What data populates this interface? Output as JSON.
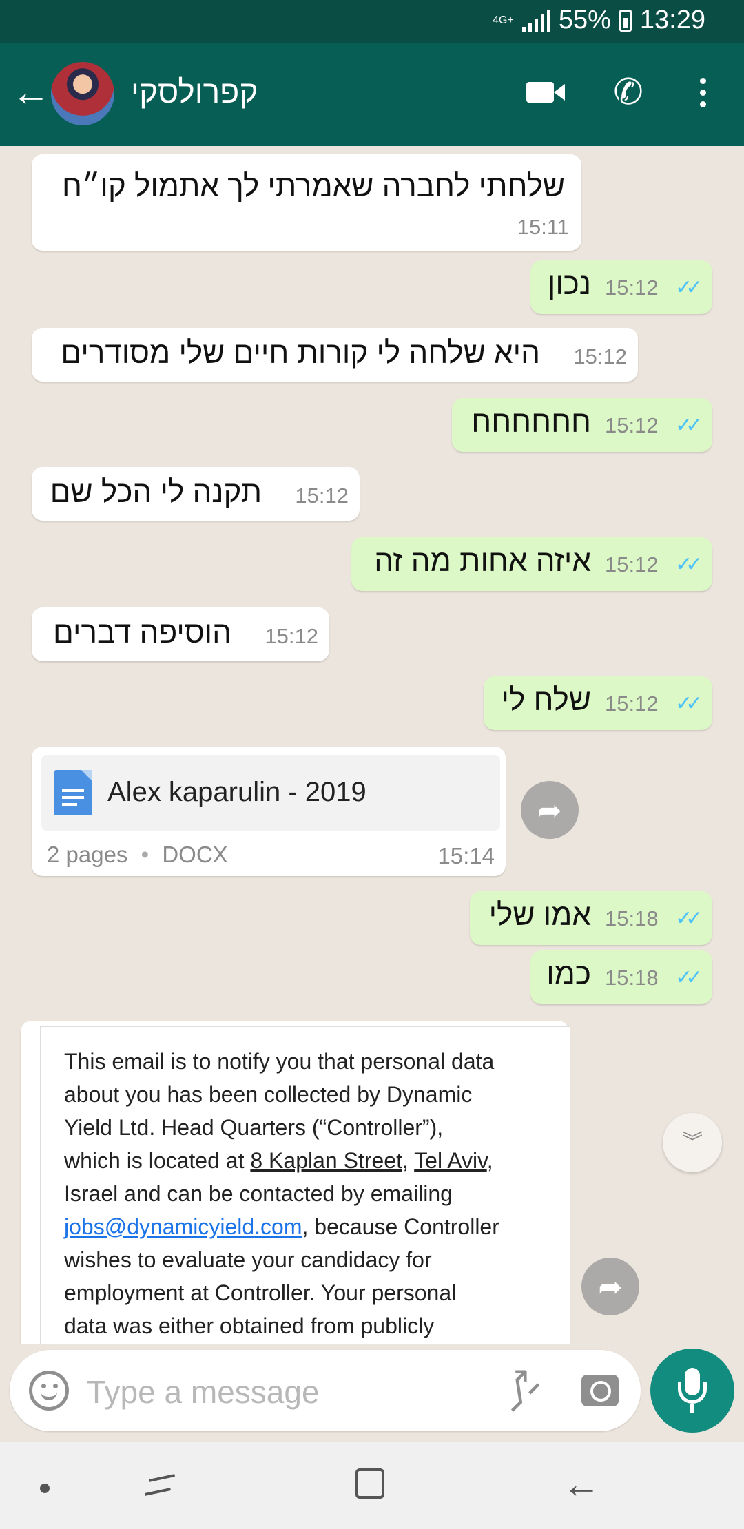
{
  "status_bar": {
    "network": "4G+",
    "battery": "55%",
    "time": "13:29"
  },
  "header": {
    "contact_name": "קפרולסקי"
  },
  "messages": [
    {
      "dir": "in",
      "text": "שלחתי לחברה שאמרתי לך אתמול קו״ח",
      "time": "15:11"
    },
    {
      "dir": "out",
      "text": "נכון",
      "time": "15:12",
      "status": "read"
    },
    {
      "dir": "in",
      "text": "היא שלחה לי קורות חיים שלי מסודרים",
      "time": "15:12"
    },
    {
      "dir": "out",
      "text": "חחחחחח",
      "time": "15:12",
      "status": "read"
    },
    {
      "dir": "in",
      "text": "תקנה לי הכל שם",
      "time": "15:12"
    },
    {
      "dir": "out",
      "text": "איזה אחות מה זה",
      "time": "15:12",
      "status": "read"
    },
    {
      "dir": "in",
      "text": "הוסיפה דברים",
      "time": "15:12"
    },
    {
      "dir": "out",
      "text": "שלח לי",
      "time": "15:12",
      "status": "read"
    },
    {
      "dir": "out",
      "text": "אמו שלי",
      "time": "15:18",
      "status": "read"
    },
    {
      "dir": "out",
      "text": "כמו",
      "time": "15:18",
      "status": "read"
    }
  ],
  "document": {
    "name": "Alex kaparulin - 2019",
    "pages": "2 pages",
    "sep": "•",
    "type": "DOCX",
    "time": "15:14"
  },
  "email_preview": {
    "l1": "This email is to notify you that personal data",
    "l2": "about you has been collected by Dynamic",
    "l3": "Yield Ltd. Head Quarters (“Controller”),",
    "l4a": "which is located at ",
    "l4b": "8 Kaplan Street",
    "l4c": ", ",
    "l4d": "Tel Aviv",
    "l4e": ",",
    "l5": "Israel and can be contacted by emailing",
    "l6a": "jobs@dynamicyield.com",
    "l6b": ", because Controller",
    "l7": "wishes to evaluate your candidacy for",
    "l8": "employment at Controller. Your personal",
    "l9": "data was either obtained from publicly"
  },
  "composer": {
    "placeholder": "Type a message"
  },
  "icons": {
    "back": "arrow-left-icon",
    "video": "video-camera-icon",
    "call": "phone-icon",
    "more": "more-vert-icon",
    "forward": "forward-icon",
    "emoji": "emoji-icon",
    "attach": "paperclip-icon",
    "camera": "camera-icon",
    "mic": "mic-icon",
    "scroll": "chevron-double-down-icon",
    "read_color": "#4fc3f7",
    "accent": "#075e54"
  }
}
